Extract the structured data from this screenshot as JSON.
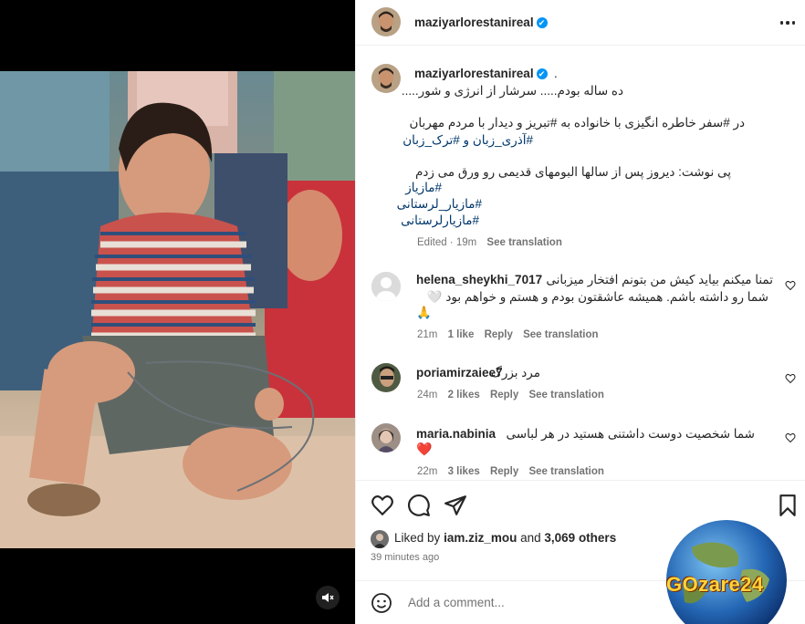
{
  "post": {
    "username": "maziyarlorestanireal",
    "verified_mark": "✔",
    "caption_dot": ".",
    "caption_lines": [
      "ده ساله بودم..... سرشار از انرژی و شور....."
    ],
    "caption_p2_line1": "در #سفر خاطره انگیزی با خانواده به #تبریز و دیدار با مردم مهربان",
    "caption_p2_line2": "#آذری_زبان و #ترک_زبان",
    "caption_p3_line1": "پی نوشت: دیروز پس از سالها البومهای قدیمی رو ورق می زدم",
    "hashtags": [
      "#مازیاز",
      "#مازیار_لرستانی",
      "#مازیارلرستانی"
    ],
    "edited_time": "Edited · 19m",
    "see_translation": "See translation"
  },
  "comments": [
    {
      "username": "helena_sheykhi_7017",
      "text_line1": "تمنا میکنم بیاید کیش من بتونم افتخار میزبانی",
      "text_line2": "شما رو داشته باشم. همیشه عاشقتون بودم و هستم و خواهم بود 🤍",
      "text_line3": "🙏",
      "time": "21m",
      "likes": "1 like",
      "reply": "Reply",
      "see_translation": "See translation"
    },
    {
      "username": "poriamirzaiee7",
      "text_line1": "مرد بزرگ",
      "time": "24m",
      "likes": "2 likes",
      "reply": "Reply",
      "see_translation": "See translation"
    },
    {
      "username": "maria.nabinia",
      "text_line1": "شما شخصیت دوست داشتنی هستید در هر لباسی",
      "text_line2": "❤️",
      "time": "22m",
      "likes": "3 likes",
      "reply": "Reply",
      "see_translation": "See translation"
    }
  ],
  "likes": {
    "prefix": "Liked by",
    "user": "iam.ziz_mou",
    "middle": "and",
    "others": "3,069 others",
    "time_ago": "39 minutes ago"
  },
  "add_comment": {
    "placeholder": "Add a comment..."
  },
  "watermark": {
    "text": "GOzare24"
  },
  "colors": {
    "link": "#00376b",
    "verified": "#0095f6",
    "muted": "#737373",
    "heart": "#ed4956"
  }
}
